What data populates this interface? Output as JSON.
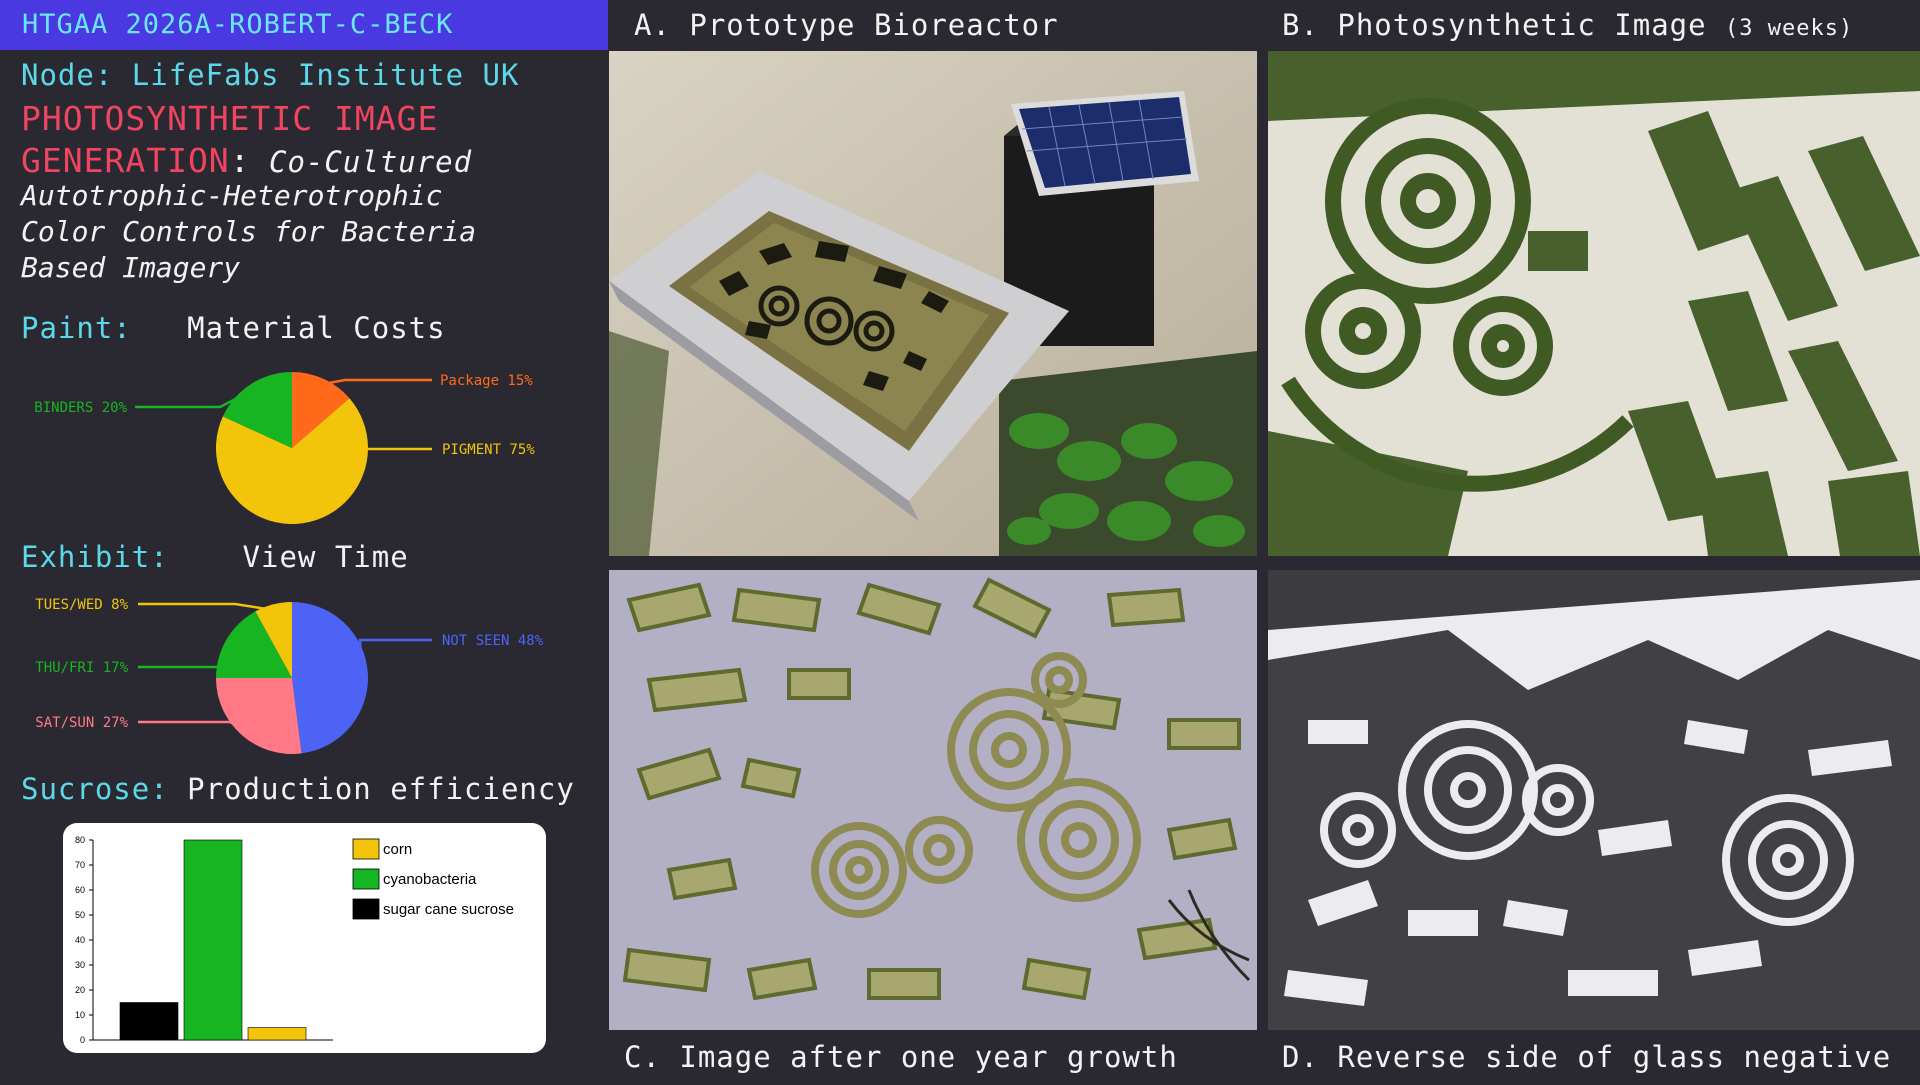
{
  "header": {
    "title": "HTGAA 2026A-ROBERT-C-BECK"
  },
  "node": {
    "label": "Node:",
    "value": "LifeFabs Institute UK"
  },
  "project": {
    "title_line1": "PHOTOSYNTHETIC IMAGE",
    "title_line2": "GENERATION",
    "colon": ":",
    "subtitle_start": " Co-Cultured",
    "subtitle_lines": [
      "Autotrophic-Heterotrophic",
      "Color Controls for Bacteria",
      "Based Imagery"
    ]
  },
  "paint": {
    "label": "Paint:",
    "title": "Material Costs"
  },
  "exhibit": {
    "label": "Exhibit:",
    "title": "View Time"
  },
  "sucrose": {
    "label": "Sucrose:",
    "title": "Production efficiency"
  },
  "colors": {
    "orange": "#ff6a1a",
    "green": "#17b521",
    "yellow": "#f2c40a",
    "blue": "#4c63f5",
    "pink": "#ff7a86",
    "cyan": "#5cd8ea",
    "red": "#ef4560",
    "title_bar": "#4a38e0"
  },
  "chart_data": [
    {
      "type": "pie",
      "slices": [
        {
          "label": "Package 15%",
          "value": 15,
          "color": "#ff6a1a"
        },
        {
          "label": "PIGMENT 75%",
          "value": 75,
          "color": "#f2c40a"
        },
        {
          "label": "BINDERS 20%",
          "value": 20,
          "color": "#17b521"
        }
      ]
    },
    {
      "type": "pie",
      "slices": [
        {
          "label": "NOT SEEN 48%",
          "value": 48,
          "color": "#4c63f5"
        },
        {
          "label": "SAT/SUN 27%",
          "value": 27,
          "color": "#ff7a86"
        },
        {
          "label": "THU/FRI 17%",
          "value": 17,
          "color": "#17b521"
        },
        {
          "label": "TUES/WED 8%",
          "value": 8,
          "color": "#f2c40a"
        }
      ]
    },
    {
      "type": "bar",
      "categories": [
        "sugar cane sucrose",
        "cyanobacteria",
        "corn"
      ],
      "values": [
        15,
        80,
        5
      ],
      "colors": [
        "#000000",
        "#17b521",
        "#f2c40a"
      ],
      "ylim": [
        0,
        80
      ],
      "yticks": [
        "0",
        "10",
        "20",
        "30",
        "40",
        "50",
        "60",
        "70",
        "80"
      ],
      "legend": [
        "corn",
        "cyanobacteria",
        "sugar cane sucrose"
      ],
      "legend_placement": "top-right"
    }
  ],
  "panels": {
    "a": {
      "caption": "A. Prototype Bioreactor"
    },
    "b": {
      "caption": "B. Photosynthetic Image",
      "note": "(3 weeks)"
    },
    "c": {
      "caption": "C. Image after one year growth"
    },
    "d": {
      "caption": "D. Reverse side of glass negative"
    }
  }
}
